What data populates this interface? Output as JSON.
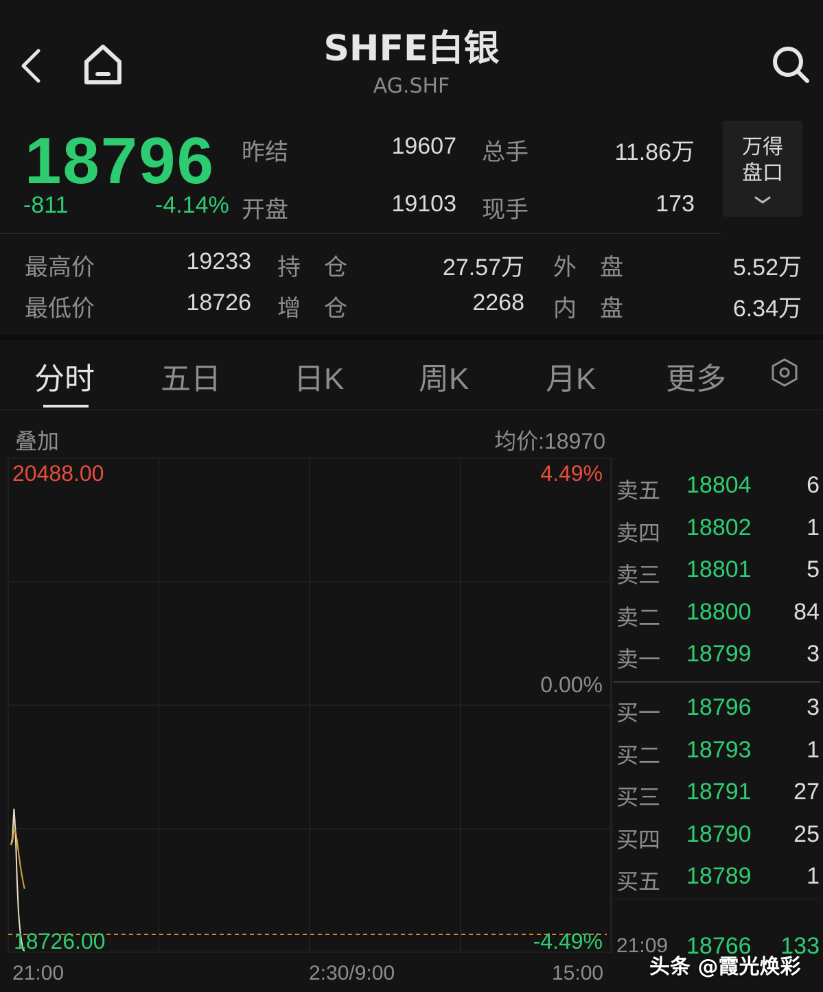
{
  "header": {
    "title": "SHFE白银",
    "subtitle": "AG.SHF",
    "back_icon": "chevron-left-icon",
    "home_icon": "home-icon",
    "search_icon": "search-icon"
  },
  "quote": {
    "price": "18796",
    "change": "-811",
    "change_pct": "-4.14%",
    "prev_settle_label": "昨结",
    "prev_settle": "19607",
    "open_label": "开盘",
    "open": "19103",
    "total_vol_label": "总手",
    "total_vol": "11.86万",
    "current_vol_label": "现手",
    "current_vol": "173",
    "wande_line1": "万得",
    "wande_line2": "盘口",
    "wande_icon": "chevron-down-icon"
  },
  "stats": {
    "high_label": "最高价",
    "high": "19233",
    "low_label": "最低价",
    "low": "18726",
    "oi_label": "持　仓",
    "oi": "27.57万",
    "oi_chg_label": "增　仓",
    "oi_chg": "2268",
    "outer_label": "外　盘",
    "outer": "5.52万",
    "inner_label": "内　盘",
    "inner": "6.34万"
  },
  "tabs": [
    "分时",
    "五日",
    "日K",
    "周K",
    "月K",
    "更多"
  ],
  "settings_icon": "settings-icon",
  "chart": {
    "overlay_label": "叠加",
    "avg_label": "均价:18970",
    "top_price": "20488.00",
    "top_pct": "4.49%",
    "mid_pct": "0.00%",
    "bottom_price": "18726.00",
    "bottom_pct": "-4.49%",
    "x_ticks": [
      "21:00",
      "2:30/9:00",
      "15:00"
    ]
  },
  "chart_data": {
    "type": "line",
    "x": [
      "21:00",
      "21:01",
      "21:02",
      "21:03",
      "21:04",
      "21:05",
      "21:06",
      "21:07",
      "21:08",
      "21:09"
    ],
    "series": [
      {
        "values": [
          19103,
          19130,
          19233,
          19150,
          18980,
          18860,
          18800,
          18760,
          18730,
          18726
        ]
      }
    ],
    "ylim": [
      18726,
      20488
    ],
    "reference_price": 19607,
    "x_axis": [
      "21:00",
      "2:30/9:00",
      "15:00"
    ],
    "grid": true,
    "colors": {
      "line": "#e8e0c0",
      "avg": "#d4a43a",
      "ref": "#e67e22"
    }
  },
  "orderbook": {
    "asks": [
      {
        "label": "卖五",
        "price": "18804",
        "vol": "6"
      },
      {
        "label": "卖四",
        "price": "18802",
        "vol": "1"
      },
      {
        "label": "卖三",
        "price": "18801",
        "vol": "5"
      },
      {
        "label": "卖二",
        "price": "18800",
        "vol": "84"
      },
      {
        "label": "卖一",
        "price": "18799",
        "vol": "3"
      }
    ],
    "bids": [
      {
        "label": "买一",
        "price": "18796",
        "vol": "3"
      },
      {
        "label": "买二",
        "price": "18793",
        "vol": "1"
      },
      {
        "label": "买三",
        "price": "18791",
        "vol": "27"
      },
      {
        "label": "买四",
        "price": "18790",
        "vol": "25"
      },
      {
        "label": "买五",
        "price": "18789",
        "vol": "1"
      }
    ],
    "last_trade": {
      "time": "21:09",
      "price": "18766",
      "vol": "133"
    }
  },
  "watermark": "头条 @霞光焕彩",
  "colors": {
    "up": "#e74c3c",
    "down": "#2ecc71",
    "background": "#141414"
  }
}
